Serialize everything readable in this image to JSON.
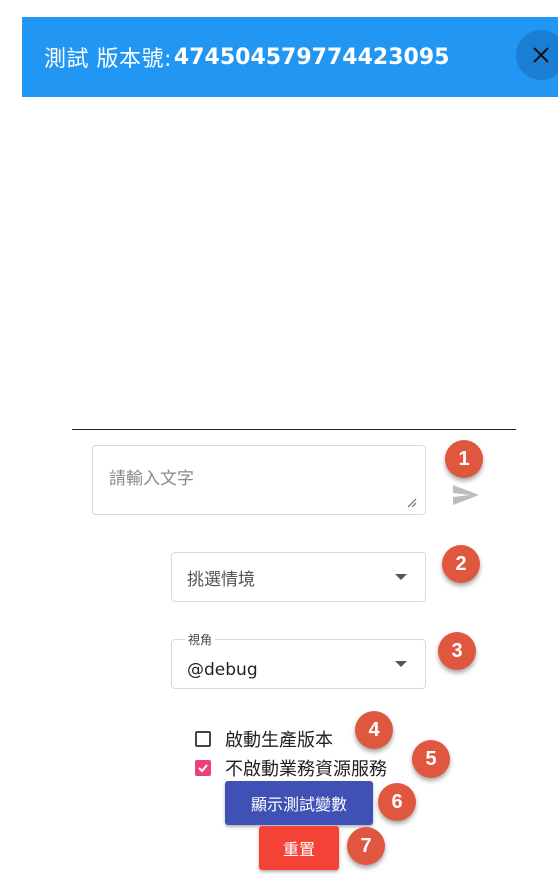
{
  "header": {
    "title_prefix": "測試 版本號:",
    "version": "474504579774423095",
    "close_icon": "close-icon"
  },
  "input": {
    "placeholder": "請輸入文字",
    "send_icon": "send-icon"
  },
  "scenario_select": {
    "placeholder": "挑選情境"
  },
  "perspective_select": {
    "label": "視角",
    "value": "@debug"
  },
  "checkboxes": [
    {
      "label": "啟動生產版本",
      "checked": false
    },
    {
      "label": "不啟動業務資源服務",
      "checked": true
    }
  ],
  "buttons": {
    "show_vars": "顯示測試變數",
    "reset": "重置"
  },
  "badges": [
    "1",
    "2",
    "3",
    "4",
    "5",
    "6",
    "7"
  ],
  "colors": {
    "header_bg": "#2196f3",
    "badge": "#e0573f",
    "primary_button": "#3f51b5",
    "reset_button": "#f44336",
    "checkbox_checked": "#ec407a"
  }
}
